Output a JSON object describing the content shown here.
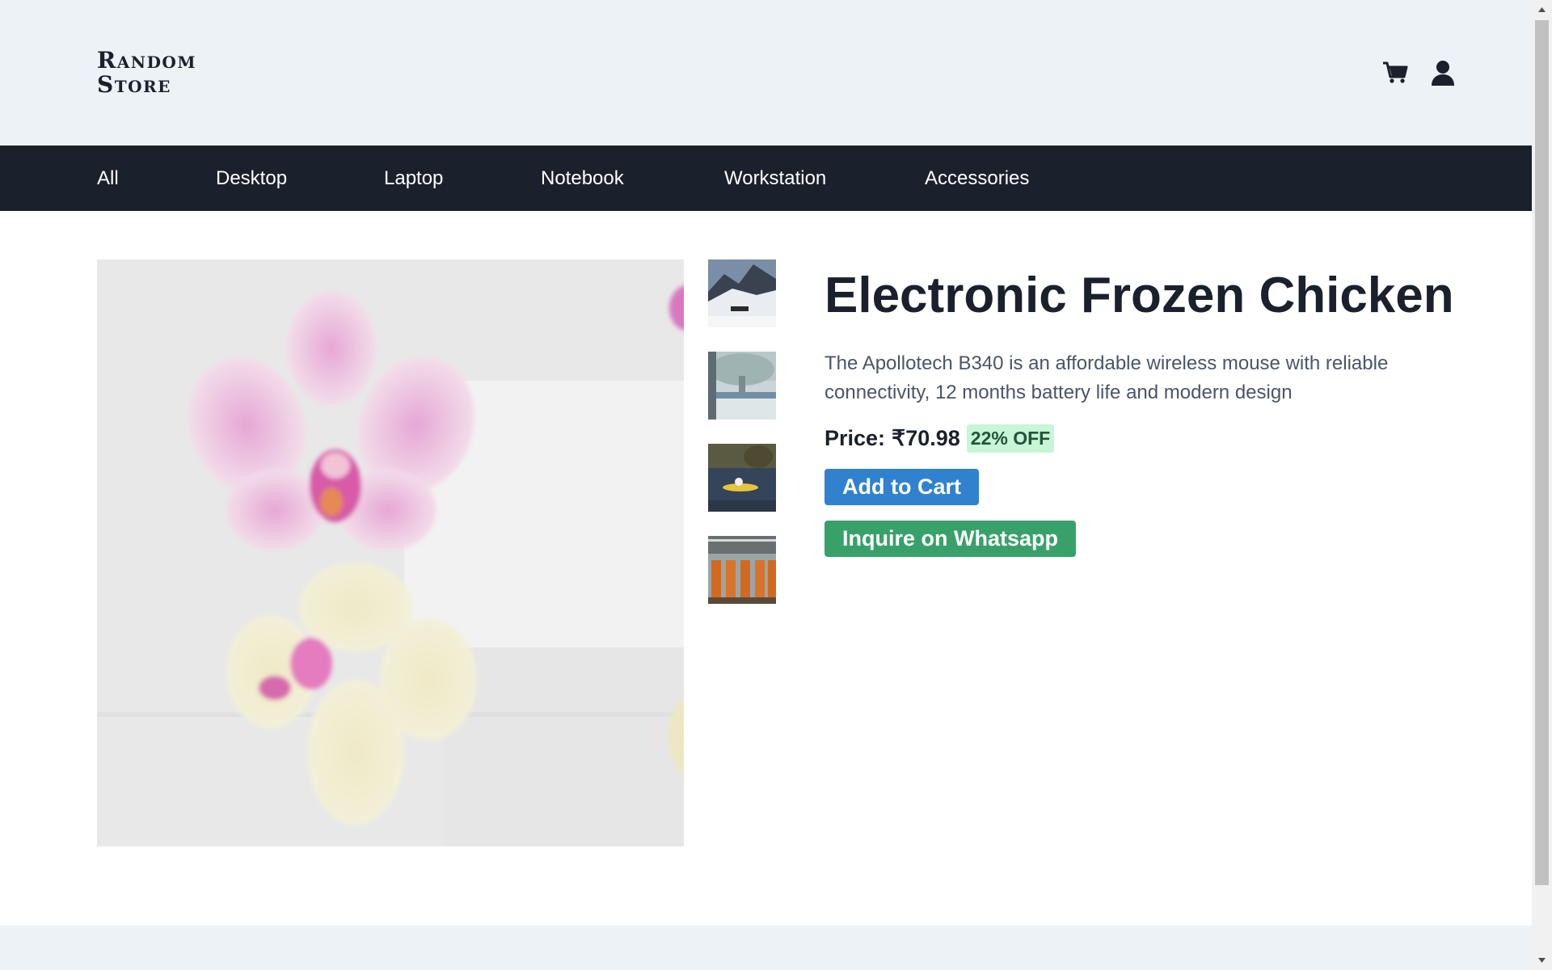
{
  "store": {
    "logo_line1": "Random",
    "logo_line2": "Store"
  },
  "header_icons": [
    "cart-icon",
    "user-icon"
  ],
  "nav": {
    "items": [
      {
        "label": "All"
      },
      {
        "label": "Desktop"
      },
      {
        "label": "Laptop"
      },
      {
        "label": "Notebook"
      },
      {
        "label": "Workstation"
      },
      {
        "label": "Accessories"
      }
    ]
  },
  "product": {
    "title": "Electronic Frozen Chicken",
    "description": "The Apollotech B340 is an affordable wireless mouse with reliable connectivity, 12 months battery life and modern design",
    "price_label": "Price:",
    "price": "₹70.98",
    "discount": "22% OFF",
    "add_to_cart": "Add to Cart",
    "inquire": "Inquire on Whatsapp",
    "main_image": "orchid-flowers-photo",
    "thumbnails": [
      "mountain-snow-photo",
      "ice-tree-photo",
      "lake-kayak-photo",
      "orange-letters-sign-photo"
    ]
  },
  "colors": {
    "header_bg": "#edf2f7",
    "nav_bg": "#1a202c",
    "primary_button": "#3182ce",
    "whatsapp_button": "#38a169",
    "discount_bg": "#c6f6d5",
    "text_dark": "#1a202c",
    "text_muted": "#4a5568"
  }
}
